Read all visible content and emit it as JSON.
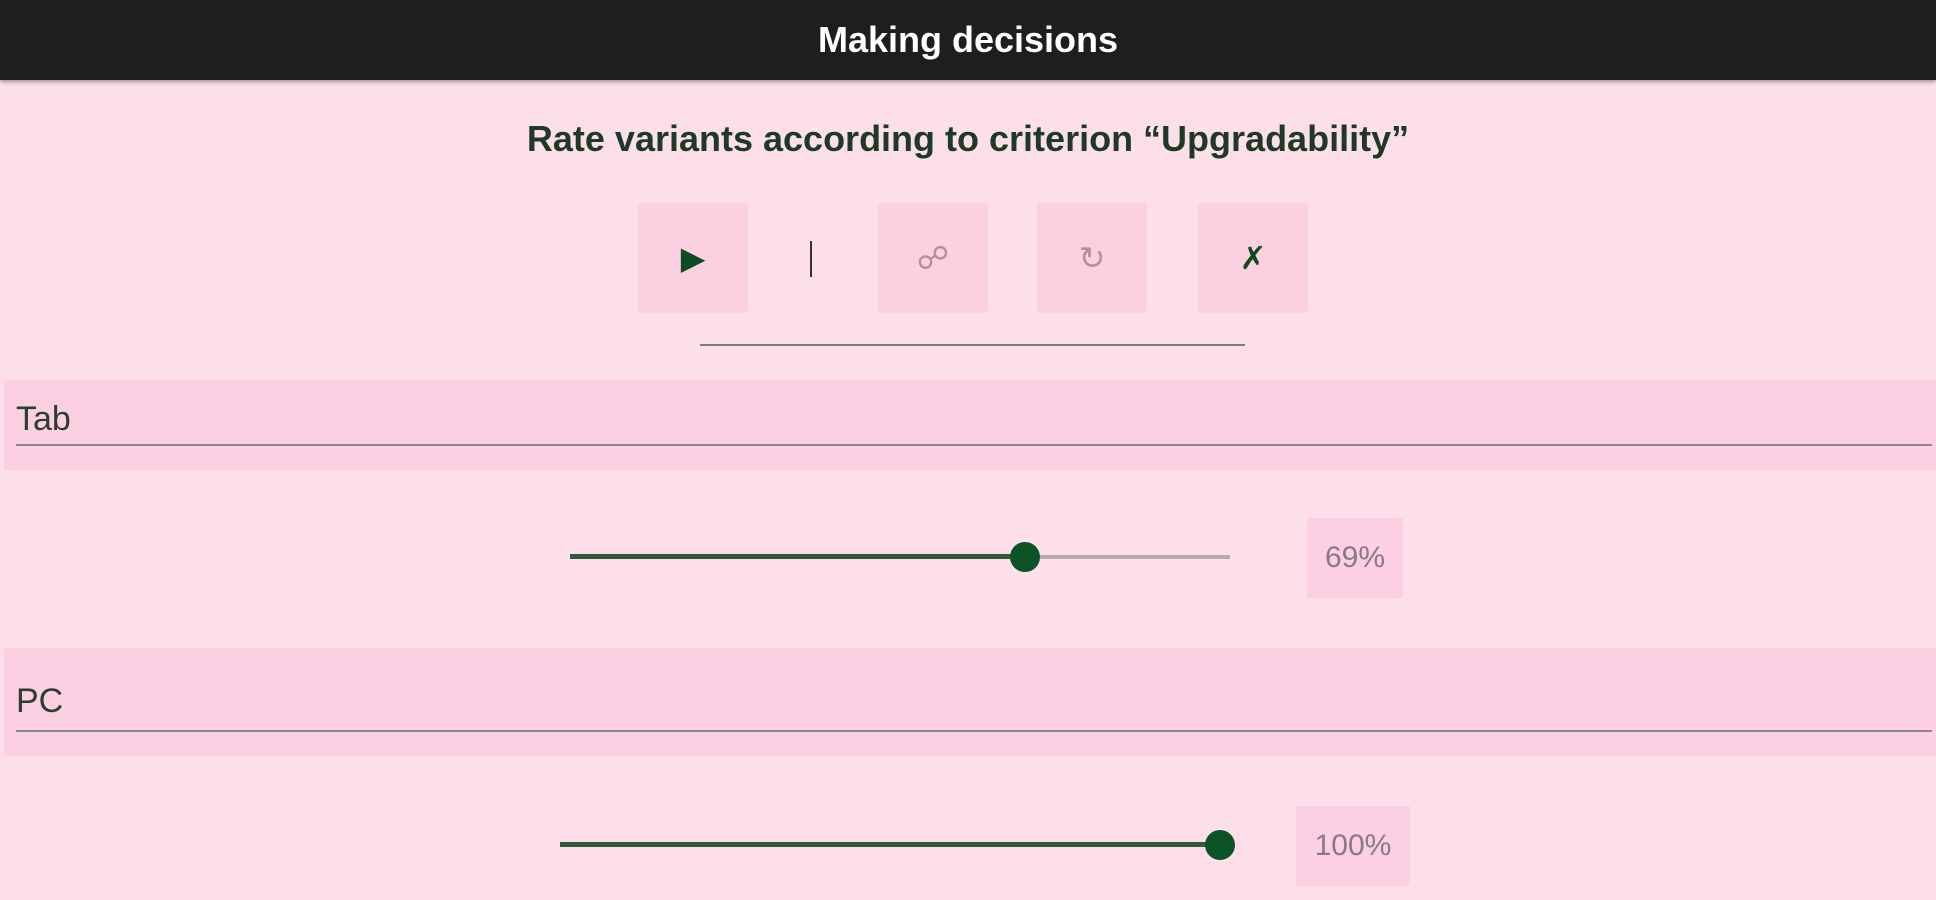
{
  "app_bar": {
    "title": "Making decisions"
  },
  "heading": "Rate variants according to criterion “Upgradability”",
  "toolbar": {
    "play_icon": "▶",
    "link_icon": "☍",
    "undo_icon": "↻",
    "close_icon": "✗"
  },
  "variants": [
    {
      "label": "Tab",
      "value": 0.69,
      "value_text": "69%"
    },
    {
      "label": "PC",
      "value": 1.0,
      "value_text": "100%"
    }
  ],
  "colors": {
    "background": "#fddfea",
    "app_bar": "#1e1e1e",
    "accent": "#0b5226"
  }
}
